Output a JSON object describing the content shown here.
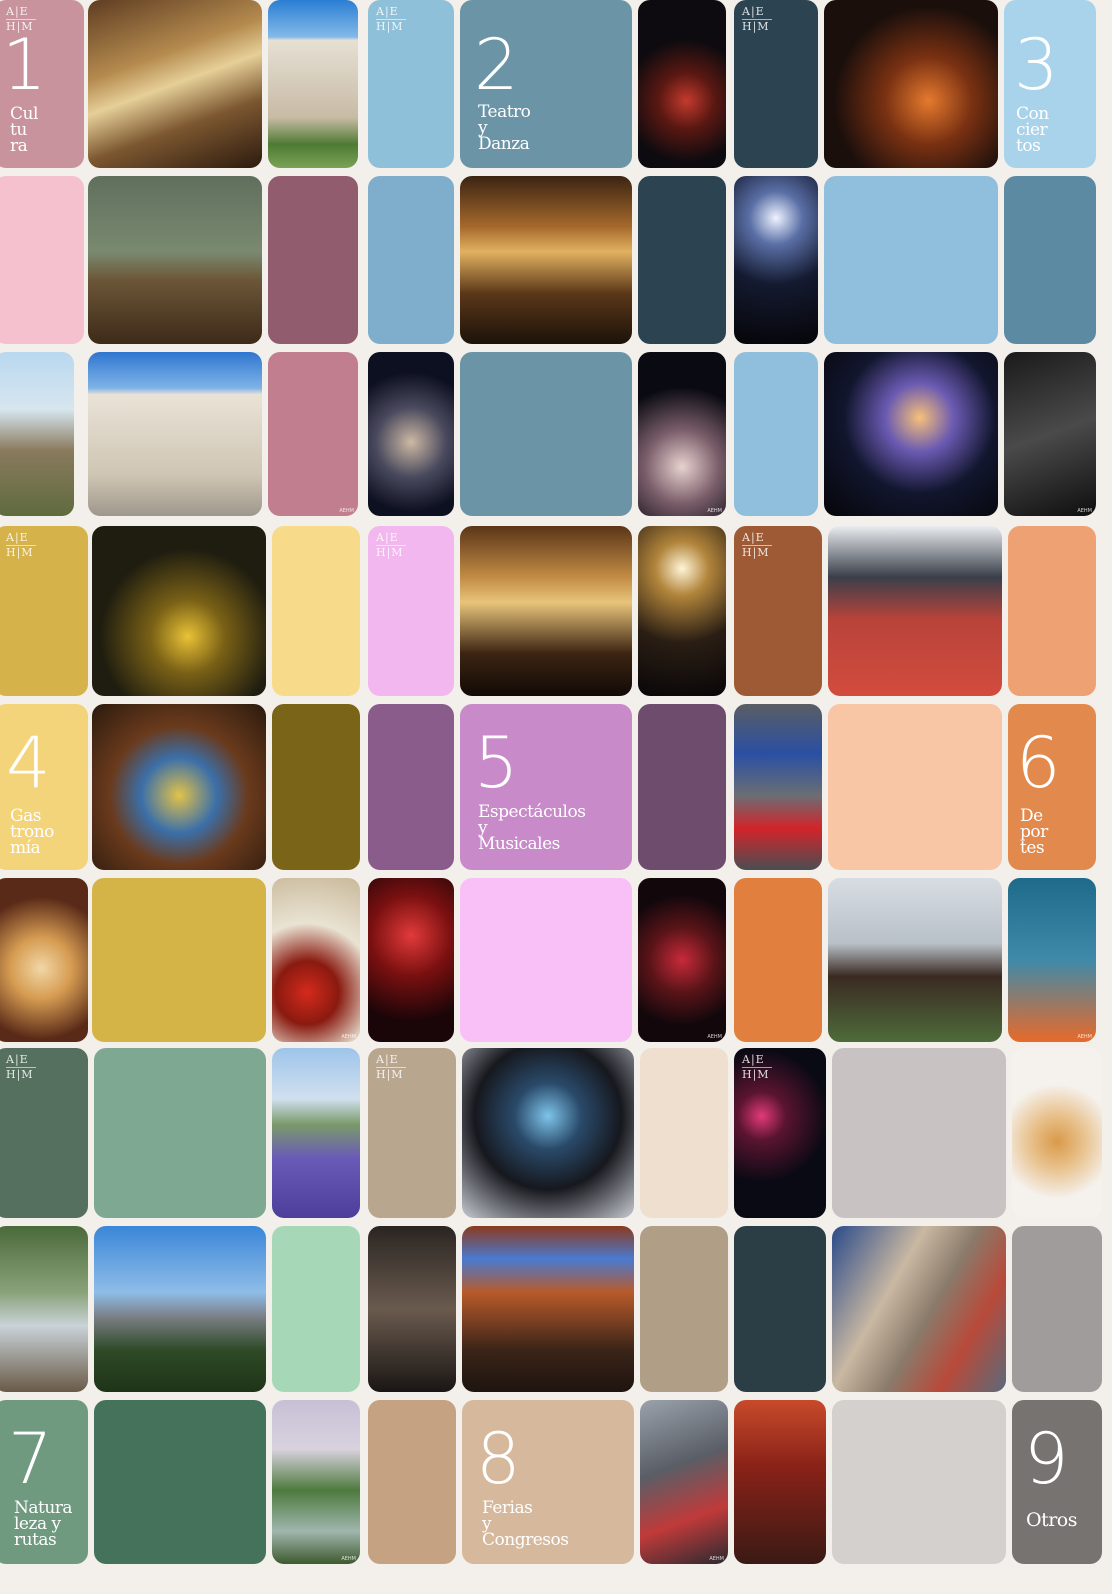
{
  "logo_top": "A|E",
  "logo_bottom": "H|M",
  "categories": [
    {
      "number": "1",
      "label": "Cul\ntu\nra"
    },
    {
      "number": "2",
      "label": "Teatro\ny\nDanza"
    },
    {
      "number": "3",
      "label": "Con\ncier\ntos"
    },
    {
      "number": "4",
      "label": "Gas\ntrono\nmía"
    },
    {
      "number": "5",
      "label": "Espectáculos\ny\nMusicales"
    },
    {
      "number": "6",
      "label": "De\npor\ntes"
    },
    {
      "number": "7",
      "label": "Natura\nleza y\nrutas"
    },
    {
      "number": "8",
      "label": "Ferias\ny\nCongresos"
    },
    {
      "number": "9",
      "label": "Otros"
    }
  ],
  "colors": {
    "background": "#f3efea",
    "cultura": [
      "#c8939d",
      "#f6c1cf",
      "#915c6e",
      "#c17e8e"
    ],
    "teatro": [
      "#8fc0da",
      "#6b95a6",
      "#7eaecb",
      "#2c4452"
    ],
    "conciertos": [
      "#2c4452",
      "#a8d3ea",
      "#8fbfdc",
      "#5c8aa3"
    ],
    "gastronomia": [
      "#d6b24a",
      "#f7da8a",
      "#7a6418",
      "#d5b447"
    ],
    "espectaculos": [
      "#f2b7ee",
      "#8a5c8c",
      "#c88ac9",
      "#6d4c6e",
      "#f8c0f7"
    ],
    "deportes": [
      "#9d5a34",
      "#eea173",
      "#f9c6a5",
      "#e28a4d",
      "#e07f3e"
    ],
    "naturaleza": [
      "#55705f",
      "#7fa892",
      "#a6d8b7",
      "#44725a",
      "#6f9a80"
    ],
    "ferias": [
      "#b9a68e",
      "#eedfcf",
      "#b19e87",
      "#c5a282",
      "#d6b99c"
    ],
    "otros": [
      "#c8c2c2",
      "#2c3e45",
      "#a09c9c",
      "#d4d0ce",
      "#777371"
    ]
  }
}
